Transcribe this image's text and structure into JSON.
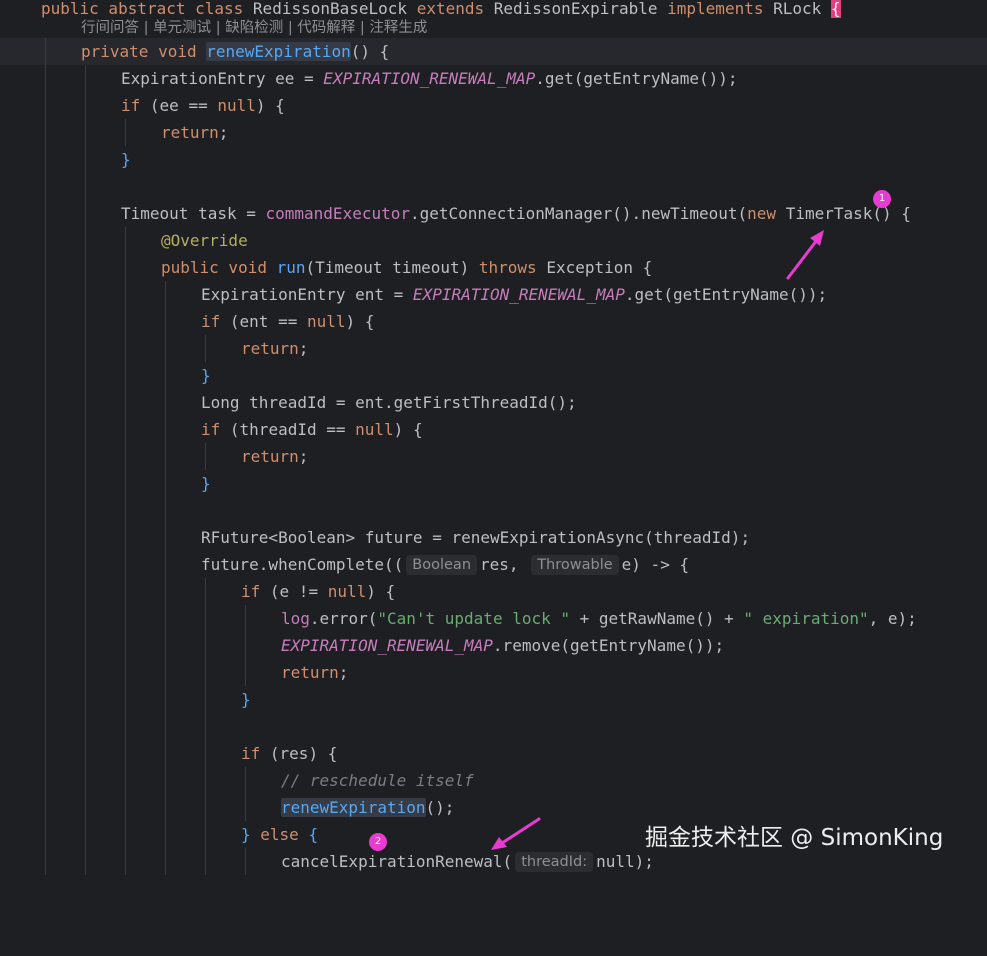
{
  "code_lens": "行间问答 | 单元测试 | 缺陷检测 | 代码解释 | 注释生成",
  "line01": {
    "p1": "public abstract class ",
    "p2": "RedissonBaseLock ",
    "p3": "extends ",
    "p4": "RedissonExpirable ",
    "p5": "implements ",
    "p6": "RLock ",
    "p7": "{"
  },
  "line02": {
    "p1": "private void ",
    "p2": "renewExpiration",
    "p3": "() {"
  },
  "line03": {
    "p1": "ExpirationEntry ee = ",
    "p2": "EXPIRATION_RENEWAL_MAP",
    "p3": ".get(getEntryName());"
  },
  "line04": {
    "p1": "if ",
    "p2": "(ee == ",
    "p3": "null",
    "p4": ") {"
  },
  "line05": {
    "p1": "return",
    "p2": ";"
  },
  "line06": {
    "p1": "}"
  },
  "line07": {
    "p1": "Timeout task = ",
    "p2": "commandExecutor",
    "p3": ".getConnectionManager().newTimeout(",
    "p4": "new ",
    "p5": "TimerTask() {"
  },
  "line08": {
    "p1": "@Override"
  },
  "line09": {
    "p1": "public void ",
    "p2": "run",
    "p3": "(Timeout timeout) ",
    "p4": "throws ",
    "p5": "Exception {"
  },
  "line10": {
    "p1": "ExpirationEntry ent = ",
    "p2": "EXPIRATION_RENEWAL_MAP",
    "p3": ".get(getEntryName());"
  },
  "line11": {
    "p1": "if ",
    "p2": "(ent == ",
    "p3": "null",
    "p4": ") {"
  },
  "line12": {
    "p1": "return",
    "p2": ";"
  },
  "line13": {
    "p1": "}"
  },
  "line14": {
    "p1": "Long threadId = ent.getFirstThreadId();"
  },
  "line15": {
    "p1": "if ",
    "p2": "(threadId == ",
    "p3": "null",
    "p4": ") {"
  },
  "line16": {
    "p1": "return",
    "p2": ";"
  },
  "line17": {
    "p1": "}"
  },
  "line18": {
    "p1": "RFuture<Boolean> future = renewExpirationAsync(threadId);"
  },
  "line19": {
    "p1": "future.whenComplete((",
    "hint1": "Boolean",
    "p2": "res, ",
    "hint2": "Throwable",
    "p3": "e) -> {"
  },
  "line20": {
    "p1": "if ",
    "p2": "(e != ",
    "p3": "null",
    "p4": ") {"
  },
  "line21": {
    "p1": "log",
    "p2": ".error(",
    "p3": "\"Can't update lock \"",
    "p4": " + getRawName() + ",
    "p5": "\" expiration\"",
    "p6": ", e);"
  },
  "line22": {
    "p1": "EXPIRATION_RENEWAL_MAP",
    "p2": ".remove(getEntryName());"
  },
  "line23": {
    "p1": "return",
    "p2": ";"
  },
  "line24": {
    "p1": "}"
  },
  "line25": {
    "p1": "if ",
    "p2": "(res) {"
  },
  "line26": {
    "p1": "// reschedule itself"
  },
  "line27": {
    "p1": "renewExpiration",
    "p2": "();"
  },
  "line28": {
    "p1": "} ",
    "p2": "else ",
    "p3": "{"
  },
  "line29": {
    "p1": "cancelExpirationRenewal(",
    "hint1": "threadId:",
    "p2": "null);"
  },
  "annotations": {
    "marker1": "1",
    "marker2": "2",
    "color": "#e83bd0"
  },
  "watermark": "掘金技术社区 @ SimonKing",
  "colors": {
    "background": "#1e1f22",
    "keyword": "#cf8e6d",
    "method": "#56a8f5",
    "constant": "#c77dbb",
    "string": "#6aab73",
    "comment": "#7a7e85",
    "annotation": "#b3ae60",
    "text": "#bcbec4"
  }
}
